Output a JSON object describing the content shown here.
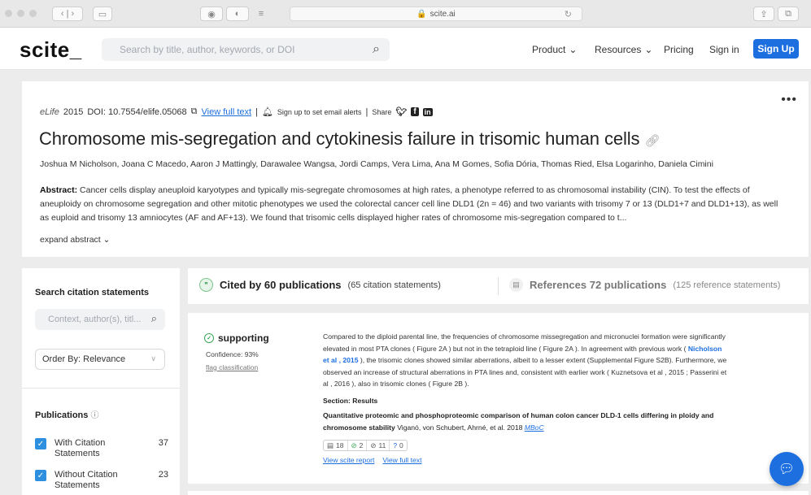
{
  "browser": {
    "url": "scite.ai"
  },
  "header": {
    "logo": "scite_",
    "search_placeholder": "Search by title, author, keywords, or DOI",
    "nav": {
      "product": "Product",
      "resources": "Resources",
      "pricing": "Pricing",
      "sign_in": "Sign in",
      "sign_up": "Sign Up"
    }
  },
  "paper": {
    "journal": "eLife",
    "year": "2015",
    "doi": "DOI: 10.7554/elife.05068",
    "view_full_text": "View full text",
    "alerts": "Sign up to set email alerts",
    "share": "Share",
    "title": "Chromosome mis-segregation and cytokinesis failure in trisomic human cells",
    "authors": "Joshua M Nicholson, Joana C Macedo, Aaron J Mattingly, Darawalee Wangsa, Jordi Camps, Vera Lima, Ana M Gomes, Sofia Dória, Thomas Ried, Elsa Logarinho, Daniela Cimini",
    "abstract_label": "Abstract:",
    "abstract_text": "Cancer cells display aneuploid karyotypes and typically mis-segregate chromosomes at high rates, a phenotype referred to as chromosomal instability (CIN). To test the effects of aneuploidy on chromosome segregation and other mitotic phenotypes we used the colorectal cancer cell line DLD1 (2n = 46) and two variants with trisomy 7 or 13 (DLD1+7 and DLD1+13), as well as euploid and trisomy 13 amniocytes (AF and AF+13). We found that trisomic cells displayed higher rates of chromosome mis-segregation compared to t...",
    "expand": "expand abstract"
  },
  "sidebar": {
    "title": "Search citation statements",
    "search_placeholder": "Context, author(s), titl...",
    "order_by": "Order By: Relevance",
    "publications_title": "Publications",
    "filters": [
      {
        "label": "With Citation Statements",
        "count": "37"
      },
      {
        "label": "Without Citation Statements",
        "count": "23"
      }
    ]
  },
  "tabs": {
    "cited_by": "Cited by 60 publications",
    "cited_sub": "(65 citation statements)",
    "references": "References 72 publications",
    "references_sub": "(125 reference statements)"
  },
  "citation": {
    "type": "supporting",
    "confidence": "Confidence: 93%",
    "flag": "flag classification",
    "excerpt_1": "Compared to the diploid parental line, the frequencies of chromosome missegregation and micronuclei formation were significantly elevated in most PTA clones ( Figure 2A ) but not in the tetraploid line ( Figure 2A ). In agreement with previous work ( ",
    "excerpt_ref1": "Nicholson et al , 2015",
    "excerpt_2": " ), the trisomic clones showed similar aberrations, albeit to a lesser extent (Supplemental Figure S2B). Furthermore, we observed an increase of structural aberrations in PTA lines and, consistent with earlier work ( ",
    "excerpt_ref2": "Kuznetsova et al , 2015",
    "excerpt_3": " ; ",
    "excerpt_ref3": "Passerini et al , 2016",
    "excerpt_4": " ), also in trisomic clones ( Figure 2B ).",
    "section": "Section: Results",
    "ref_title": "Quantitative proteomic and phosphoproteomic comparison of human colon cancer DLD-1 cells differing in ploidy and chromosome stability",
    "ref_authors": " Viganó, von Schubert, Ahrné, et al. 2018 ",
    "ref_journal": "MBoC",
    "badges": {
      "total": "18",
      "supporting": "2",
      "mentioning": "11",
      "contrasting": "0"
    },
    "view_report": "View scite report",
    "view_full_text": "View full text"
  },
  "colors": {
    "accent": "#1d6fe0",
    "supporting": "#3aa757",
    "checkbox": "#2d8fe0"
  }
}
